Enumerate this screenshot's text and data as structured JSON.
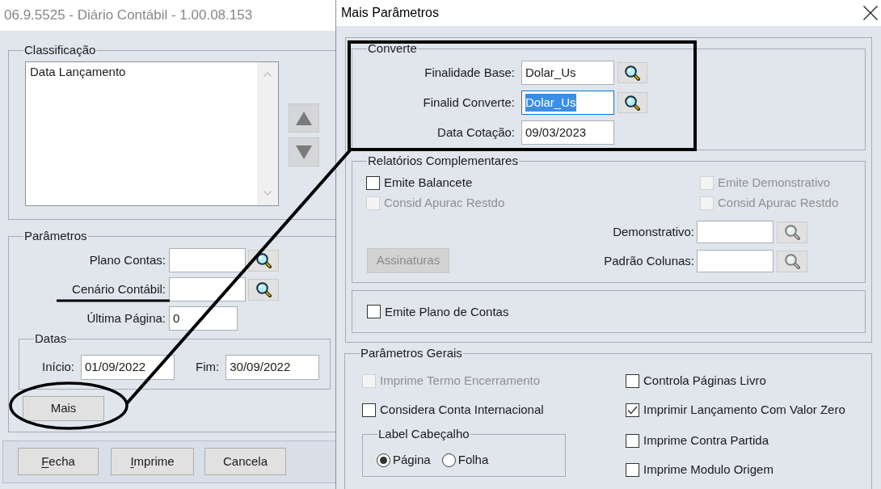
{
  "main_window": {
    "title": "06.9.5525 - Diário Contábil - 1.00.08.153",
    "classification": {
      "legend": "Classificação",
      "items": [
        "Data Lançamento"
      ]
    },
    "parameters": {
      "legend": "Parâmetros",
      "fields": [
        {
          "label": "Plano Contas:",
          "lookup": true
        },
        {
          "label": "Cenário Contábil:",
          "lookup": true
        },
        {
          "label": "Última Página:",
          "value": "0",
          "lookup": false
        }
      ],
      "dates": {
        "legend": "Datas",
        "fields": [
          {
            "label": "Início:",
            "value": "01/09/2022"
          },
          {
            "label": "Fim:",
            "value": "30/09/2022"
          }
        ]
      },
      "more_button": "Mais"
    },
    "buttons": [
      {
        "label": "Fecha",
        "mnemonic": true
      },
      {
        "label": "Imprime",
        "mnemonic": true
      },
      {
        "label": "Cancela",
        "mnemonic": false
      }
    ]
  },
  "dialog": {
    "title": "Mais Parâmetros",
    "convert": {
      "legend": "Converte",
      "fields": [
        {
          "label": "Finalidade Base:",
          "value": "Dolar_Us",
          "lookup": true,
          "focused": false
        },
        {
          "label": "Finalid Converte:",
          "value": "Dolar_Us",
          "lookup": true,
          "focused": true
        },
        {
          "label": "Data Cotação:",
          "value": "09/03/2023",
          "lookup": false,
          "focused": false
        }
      ]
    },
    "complementary_reports": {
      "legend": "Relatórios Complementares",
      "options": [
        {
          "label": "Emite Balancete",
          "checked": false,
          "disabled": false
        },
        {
          "label": "Emite Demonstrativo",
          "checked": false,
          "disabled": true
        },
        {
          "label": "Consid Apurac Restdo",
          "checked": false,
          "disabled": true
        },
        {
          "label": "Consid Apurac Restdo",
          "checked": false,
          "disabled": true
        }
      ],
      "signatures_button": {
        "label": "Assinaturas",
        "disabled": true
      },
      "lookups": [
        {
          "label": "Demonstrativo:",
          "disabled": true
        },
        {
          "label": "Padrão Colunas:",
          "disabled": true
        }
      ]
    },
    "chart_of_accounts": {
      "label": "Emite Plano de Contas",
      "checked": false,
      "disabled": false
    },
    "general": {
      "legend": "Parâmetros Gerais",
      "left_options": [
        {
          "label": "Imprime Termo Encerramento",
          "checked": false,
          "disabled": true
        },
        {
          "label": "Considera Conta Internacional",
          "checked": false,
          "disabled": false
        }
      ],
      "header_label": {
        "legend": "Label Cabeçalho",
        "options": [
          {
            "label": "Página",
            "selected": true
          },
          {
            "label": "Folha",
            "selected": false
          }
        ]
      },
      "right_options": [
        {
          "label": "Controla Páginas Livro",
          "checked": false,
          "disabled": false
        },
        {
          "label": "Imprimir Lançamento Com Valor Zero",
          "checked": true,
          "disabled": false
        },
        {
          "label": "Imprime Contra Partida",
          "checked": false,
          "disabled": false
        },
        {
          "label": "Imprime Modulo Origem",
          "checked": false,
          "disabled": false
        }
      ]
    }
  }
}
